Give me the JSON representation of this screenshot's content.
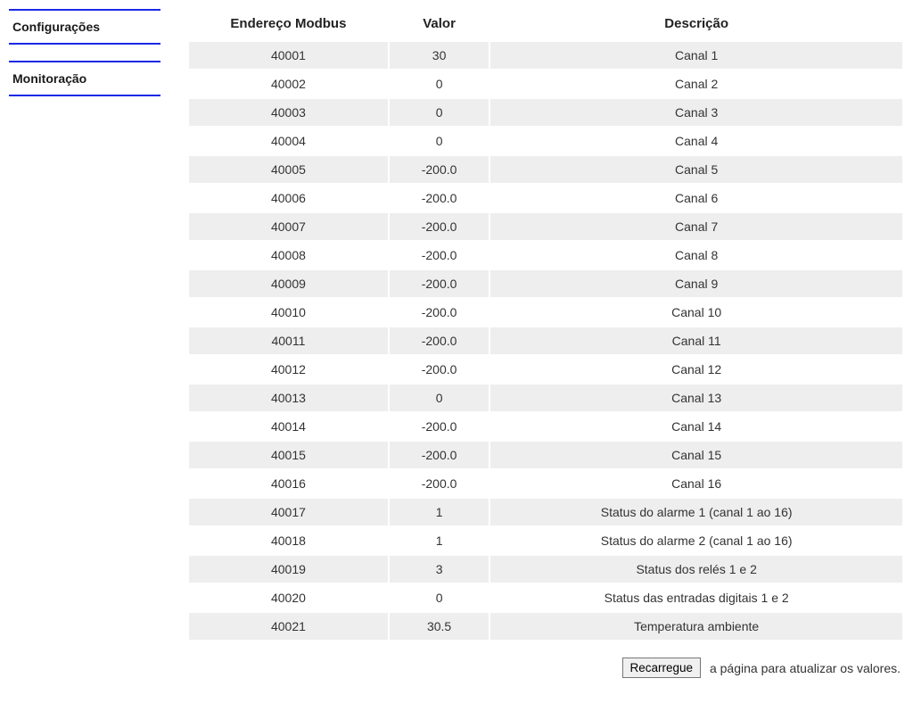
{
  "sidebar": {
    "items": [
      {
        "label": "Configurações"
      },
      {
        "label": "Monitoração"
      }
    ]
  },
  "table": {
    "headers": {
      "address": "Endereço Modbus",
      "value": "Valor",
      "description": "Descrição"
    },
    "rows": [
      {
        "address": "40001",
        "value": "30",
        "description": "Canal 1"
      },
      {
        "address": "40002",
        "value": "0",
        "description": "Canal 2"
      },
      {
        "address": "40003",
        "value": "0",
        "description": "Canal 3"
      },
      {
        "address": "40004",
        "value": "0",
        "description": "Canal 4"
      },
      {
        "address": "40005",
        "value": "-200.0",
        "description": "Canal 5"
      },
      {
        "address": "40006",
        "value": "-200.0",
        "description": "Canal 6"
      },
      {
        "address": "40007",
        "value": "-200.0",
        "description": "Canal 7"
      },
      {
        "address": "40008",
        "value": "-200.0",
        "description": "Canal 8"
      },
      {
        "address": "40009",
        "value": "-200.0",
        "description": "Canal 9"
      },
      {
        "address": "40010",
        "value": "-200.0",
        "description": "Canal 10"
      },
      {
        "address": "40011",
        "value": "-200.0",
        "description": "Canal 11"
      },
      {
        "address": "40012",
        "value": "-200.0",
        "description": "Canal 12"
      },
      {
        "address": "40013",
        "value": "0",
        "description": "Canal 13"
      },
      {
        "address": "40014",
        "value": "-200.0",
        "description": "Canal 14"
      },
      {
        "address": "40015",
        "value": "-200.0",
        "description": "Canal 15"
      },
      {
        "address": "40016",
        "value": "-200.0",
        "description": "Canal 16"
      },
      {
        "address": "40017",
        "value": "1",
        "description": "Status do alarme 1 (canal 1 ao 16)"
      },
      {
        "address": "40018",
        "value": "1",
        "description": "Status do alarme 2 (canal 1 ao 16)"
      },
      {
        "address": "40019",
        "value": "3",
        "description": "Status dos relés 1 e 2"
      },
      {
        "address": "40020",
        "value": "0",
        "description": "Status das entradas digitais 1 e 2"
      },
      {
        "address": "40021",
        "value": "30.5",
        "description": "Temperatura ambiente"
      }
    ]
  },
  "footer": {
    "button_label": "Recarregue",
    "text": "a página para atualizar os valores."
  }
}
